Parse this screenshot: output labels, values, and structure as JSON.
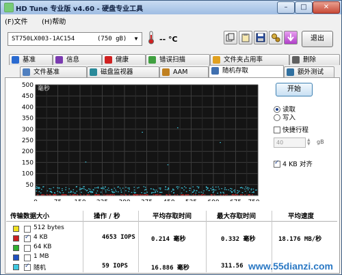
{
  "window": {
    "title": "HD Tune 专业版 v4.60 - 硬盘专业工具",
    "minimize": "–",
    "maximize": "□",
    "close": "✕"
  },
  "menu": {
    "file": "(F)文件",
    "help": "(H)帮助"
  },
  "toolbar": {
    "drive_name": "ST750LX003-1AC154",
    "drive_size": "(750 gB)",
    "temperature": "-- °C",
    "exit": "退出"
  },
  "tabs_row1": [
    {
      "label": "基准",
      "icon": "chart-icon"
    },
    {
      "label": "信息",
      "icon": "info-icon"
    },
    {
      "label": "健康",
      "icon": "health-cross-icon"
    },
    {
      "label": "错误扫描",
      "icon": "magnifier-icon"
    },
    {
      "label": "文件夹占用率",
      "icon": "folder-icon"
    },
    {
      "label": "删除",
      "icon": "trash-icon"
    }
  ],
  "tabs_row2": [
    {
      "label": "文件基准",
      "icon": "file-icon"
    },
    {
      "label": "磁盘监视器",
      "icon": "monitor-icon"
    },
    {
      "label": "AAM",
      "icon": "speaker-icon"
    },
    {
      "label": "随机存取",
      "icon": "random-access-icon"
    },
    {
      "label": "额外测试",
      "icon": "extra-test-icon"
    }
  ],
  "active_tab": "随机存取",
  "chart_data": {
    "type": "scatter",
    "ylabel": "毫秒",
    "ylim": [
      0,
      50
    ],
    "xlim": [
      0,
      750
    ],
    "y_ticks": [
      "500",
      "450",
      "400",
      "350",
      "300",
      "250",
      "200",
      "150",
      "100",
      "50"
    ],
    "x_ticks": [
      "0",
      "75",
      "150",
      "225",
      "300",
      "375",
      "450",
      "525",
      "600",
      "675",
      "750gB"
    ],
    "grid": true,
    "series": [
      {
        "name": "4 KB",
        "color": "#cc2020",
        "latency_ms_range": [
          0.2,
          0.33
        ]
      },
      {
        "name": "随机",
        "color": "#3ec8e0",
        "latency_ms_range": [
          1,
          31
        ]
      }
    ]
  },
  "controls": {
    "start": "开始",
    "read": "读取",
    "write": "写入",
    "read_selected": true,
    "short_stroke": "快捷行程",
    "short_stroke_checked": false,
    "short_stroke_value": "40",
    "short_stroke_unit": "gB",
    "align_4kb": "4 KB 对齐",
    "align_4kb_checked": true
  },
  "results": {
    "headers": [
      "传输数据大小",
      "操作 / 秒",
      "平均存取时间",
      "最大存取时间",
      "平均速度"
    ],
    "rows": [
      {
        "label": "512 bytes",
        "color": "#f0e020",
        "checked": false,
        "ops": "",
        "avg": "",
        "max": "",
        "speed": ""
      },
      {
        "label": "4 KB",
        "color": "#cc2020",
        "checked": true,
        "ops": "4653 IOPS",
        "avg": "0.214 毫秒",
        "max": "0.332 毫秒",
        "speed": "18.176 MB/秒"
      },
      {
        "label": "64 KB",
        "color": "#30b030",
        "checked": false,
        "ops": "",
        "avg": "",
        "max": "",
        "speed": ""
      },
      {
        "label": "1 MB",
        "color": "#2050c0",
        "checked": false,
        "ops": "",
        "avg": "",
        "max": "",
        "speed": ""
      },
      {
        "label": "随机",
        "color": "#3ec8e0",
        "checked": true,
        "ops": "59 IOPS",
        "avg": "16.886 毫秒",
        "max": "311.56",
        "speed": ""
      }
    ]
  },
  "watermark": "www.55dianzi.com"
}
